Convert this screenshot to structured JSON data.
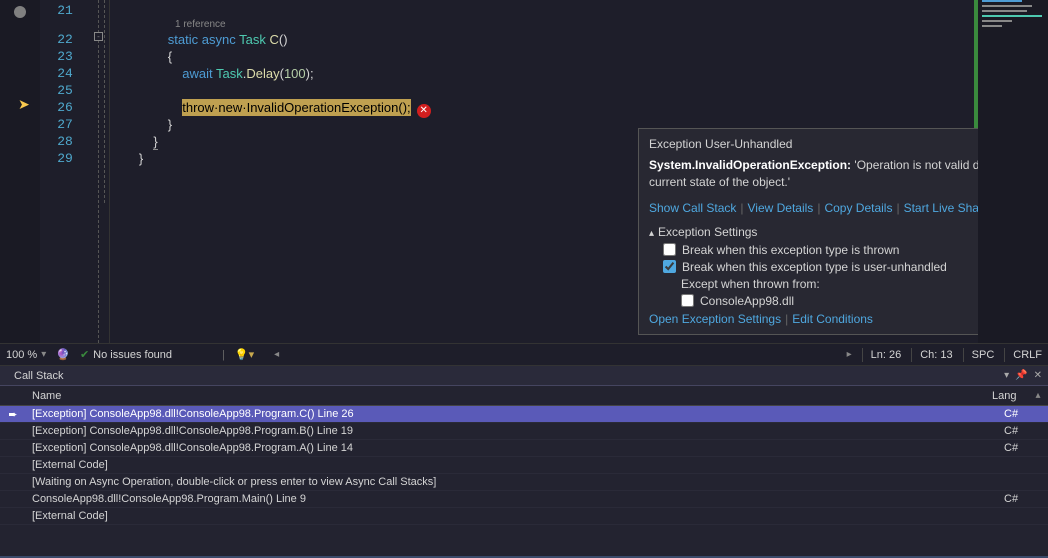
{
  "editor": {
    "lines": [
      21,
      22,
      23,
      24,
      25,
      26,
      27,
      28,
      29
    ],
    "code_lens": "1 reference",
    "line22": {
      "kw_static": "static",
      "kw_async": "async",
      "type_task": "Task",
      "method": "C",
      "parens": "()"
    },
    "line23": "{",
    "line24": {
      "kw_await": "await",
      "type_task": "Task",
      "method": "Delay",
      "arg": "100"
    },
    "line26": {
      "kw_throw": "throw",
      "kw_new": "new",
      "type": "InvalidOperationException",
      "parens": "();"
    },
    "line27": "}",
    "line28": "}",
    "line29": "}"
  },
  "exception_popup": {
    "title": "Exception User-Unhandled",
    "exception_type": "System.InvalidOperationException:",
    "message": "'Operation is not valid due to the current state of the object.'",
    "links": {
      "show_call_stack": "Show Call Stack",
      "view_details": "View Details",
      "copy_details": "Copy Details",
      "live_share": "Start Live Share session"
    },
    "settings_title": "Exception Settings",
    "checkbox_thrown": "Break when this exception type is thrown",
    "checkbox_unhandled": "Break when this exception type is user-unhandled",
    "except_label": "Except when thrown from:",
    "except_item": "ConsoleApp98.dll",
    "open_settings": "Open Exception Settings",
    "edit_conditions": "Edit Conditions"
  },
  "status": {
    "zoom": "100 %",
    "issues": "No issues found",
    "ln": "Ln: 26",
    "ch": "Ch: 13",
    "spc": "SPC",
    "crlf": "CRLF"
  },
  "callstack": {
    "title": "Call Stack",
    "col_name": "Name",
    "col_lang": "Lang",
    "rows": [
      {
        "name": "[Exception] ConsoleApp98.dll!ConsoleApp98.Program.C() Line 26",
        "lang": "C#",
        "current": true
      },
      {
        "name": "[Exception] ConsoleApp98.dll!ConsoleApp98.Program.B() Line 19",
        "lang": "C#",
        "current": false
      },
      {
        "name": "[Exception] ConsoleApp98.dll!ConsoleApp98.Program.A() Line 14",
        "lang": "C#",
        "current": false
      },
      {
        "name": "[External Code]",
        "lang": "",
        "current": false
      },
      {
        "name": "[Waiting on Async Operation, double-click or press enter to view Async Call Stacks]",
        "lang": "",
        "current": false
      },
      {
        "name": "ConsoleApp98.dll!ConsoleApp98.Program.Main() Line 9",
        "lang": "C#",
        "current": false
      },
      {
        "name": "[External Code]",
        "lang": "",
        "current": false
      }
    ]
  }
}
